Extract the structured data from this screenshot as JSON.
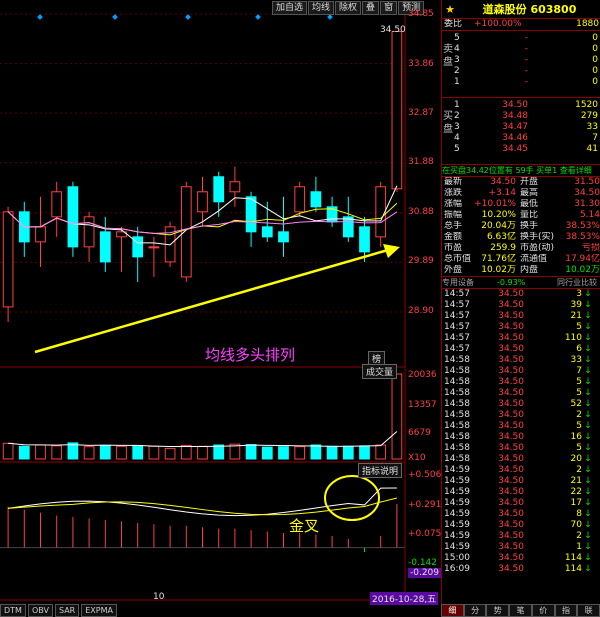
{
  "toolbar": [
    "加自选",
    "均线",
    "除权",
    "叠",
    "窗",
    "预测"
  ],
  "price_axis": [
    "34.85",
    "33.86",
    "32.87",
    "31.88",
    "30.88",
    "29.89",
    "28.90"
  ],
  "max_label": "34.50",
  "vol_axis": [
    "20036",
    "13357",
    "6679",
    "X10"
  ],
  "vol_tag": "成交量",
  "top_tag": "榜",
  "macd_axis": [
    "+0.506",
    "+0.291",
    "+0.075",
    "-0.142",
    "-0.209"
  ],
  "macd_tag": "指标说明",
  "annot_ma": "均线多头排列",
  "annot_cross": "金叉",
  "x_label": "10",
  "date_label": "2016-10-28,五",
  "bottom_tabs": [
    "DTM",
    "OBV",
    "SAR",
    "EXPMA"
  ],
  "colors": {
    "up": "#ff4040",
    "down": "#00ffff",
    "ma5": "#ffffff",
    "ma10": "#ffff00",
    "ma20": "#ff80ff"
  },
  "quote": {
    "name": "道森股份 603800",
    "weibi_label": "委比",
    "weibi_value": "+100.00%",
    "weibi_num": "1880",
    "sell_label": "卖盘",
    "sells": [
      {
        "n": "5",
        "p": "-",
        "v": "0"
      },
      {
        "n": "4",
        "p": "-",
        "v": "0"
      },
      {
        "n": "3",
        "p": "-",
        "v": "0"
      },
      {
        "n": "2",
        "p": "-",
        "v": "0"
      },
      {
        "n": "1",
        "p": "-",
        "v": "0"
      }
    ],
    "buy_label": "买盘",
    "buys": [
      {
        "n": "1",
        "p": "34.50",
        "v": "1520"
      },
      {
        "n": "2",
        "p": "34.48",
        "v": "279"
      },
      {
        "n": "3",
        "p": "34.47",
        "v": "33"
      },
      {
        "n": "4",
        "p": "34.46",
        "v": "7"
      },
      {
        "n": "5",
        "p": "34.45",
        "v": "41"
      }
    ],
    "info_line": "在买盘34.42位置有  59手  买单1 查看详细",
    "stats": [
      [
        "最新",
        "34.50",
        "开盘",
        "31.50"
      ],
      [
        "涨跌",
        "+3.14",
        "最高",
        "34.50"
      ],
      [
        "涨幅",
        "+10.01%",
        "最低",
        "31.30"
      ],
      [
        "振幅",
        "10.20%",
        "量比",
        "5.14"
      ],
      [
        "总手",
        "20.04万",
        "换手",
        "38.53%"
      ],
      [
        "金额",
        "6.63亿",
        "换手(实)",
        "38.53%"
      ],
      [
        "市盈",
        "259.9",
        "市盈(动)",
        "亏损"
      ],
      [
        "总市值",
        "71.76亿",
        "流通值",
        "17.94亿"
      ],
      [
        "外盘",
        "10.02万",
        "内盘",
        "10.02万"
      ]
    ],
    "ticks_header": [
      "专用设备",
      "-0.93%",
      "同行业比较"
    ],
    "ticks": [
      [
        "14:57",
        "34.50",
        "3"
      ],
      [
        "14:57",
        "34.50",
        "39"
      ],
      [
        "14:57",
        "34.50",
        "21"
      ],
      [
        "14:57",
        "34.50",
        "5"
      ],
      [
        "14:57",
        "34.50",
        "110"
      ],
      [
        "14:57",
        "34.50",
        "6"
      ],
      [
        "14:58",
        "34.50",
        "33"
      ],
      [
        "14:58",
        "34.50",
        "7"
      ],
      [
        "14:58",
        "34.50",
        "5"
      ],
      [
        "14:58",
        "34.50",
        "5"
      ],
      [
        "14:58",
        "34.50",
        "52"
      ],
      [
        "14:58",
        "34.50",
        "2"
      ],
      [
        "14:58",
        "34.50",
        "5"
      ],
      [
        "14:58",
        "34.50",
        "16"
      ],
      [
        "14:58",
        "34.50",
        "5"
      ],
      [
        "14:58",
        "34.50",
        "20"
      ],
      [
        "14:59",
        "34.50",
        "2"
      ],
      [
        "14:59",
        "34.50",
        "21"
      ],
      [
        "14:59",
        "34.50",
        "22"
      ],
      [
        "14:59",
        "34.50",
        "17"
      ],
      [
        "14:59",
        "34.50",
        "8"
      ],
      [
        "14:59",
        "34.50",
        "70"
      ],
      [
        "14:59",
        "34.50",
        "2"
      ],
      [
        "14:59",
        "34.50",
        "1"
      ],
      [
        "15:00",
        "34.50",
        "114"
      ],
      [
        "16:09",
        "34.50",
        "114"
      ]
    ],
    "right_tabs": [
      "细",
      "分",
      "势",
      "笔",
      "价",
      "指",
      "联"
    ]
  },
  "chart_data": {
    "type": "candlestick",
    "price_range": [
      28.4,
      34.85
    ],
    "candles": [
      {
        "o": 29.0,
        "c": 30.9,
        "h": 31.0,
        "l": 28.7
      },
      {
        "o": 30.9,
        "c": 30.3,
        "h": 31.1,
        "l": 30.0
      },
      {
        "o": 30.3,
        "c": 30.6,
        "h": 31.2,
        "l": 29.8
      },
      {
        "o": 30.8,
        "c": 31.3,
        "h": 31.5,
        "l": 30.4
      },
      {
        "o": 31.4,
        "c": 30.2,
        "h": 31.5,
        "l": 30.0
      },
      {
        "o": 30.2,
        "c": 30.8,
        "h": 30.9,
        "l": 29.9
      },
      {
        "o": 30.5,
        "c": 29.9,
        "h": 30.8,
        "l": 29.7
      },
      {
        "o": 30.4,
        "c": 30.5,
        "h": 30.6,
        "l": 29.7
      },
      {
        "o": 30.4,
        "c": 30.0,
        "h": 30.6,
        "l": 29.5
      },
      {
        "o": 30.2,
        "c": 30.2,
        "h": 30.4,
        "l": 29.6
      },
      {
        "o": 29.9,
        "c": 30.6,
        "h": 30.7,
        "l": 29.8
      },
      {
        "o": 29.6,
        "c": 31.4,
        "h": 31.5,
        "l": 29.5
      },
      {
        "o": 30.9,
        "c": 31.3,
        "h": 31.6,
        "l": 30.6
      },
      {
        "o": 31.6,
        "c": 31.1,
        "h": 31.7,
        "l": 30.8
      },
      {
        "o": 31.3,
        "c": 31.5,
        "h": 31.8,
        "l": 31.0
      },
      {
        "o": 31.2,
        "c": 30.5,
        "h": 31.3,
        "l": 30.2
      },
      {
        "o": 30.6,
        "c": 30.4,
        "h": 31.1,
        "l": 30.3
      },
      {
        "o": 30.5,
        "c": 30.3,
        "h": 31.2,
        "l": 30.0
      },
      {
        "o": 30.9,
        "c": 31.4,
        "h": 31.5,
        "l": 30.8
      },
      {
        "o": 31.3,
        "c": 31.0,
        "h": 31.6,
        "l": 30.9
      },
      {
        "o": 31.0,
        "c": 30.7,
        "h": 31.2,
        "l": 30.6
      },
      {
        "o": 30.8,
        "c": 30.4,
        "h": 31.2,
        "l": 30.3
      },
      {
        "o": 30.6,
        "c": 30.1,
        "h": 30.8,
        "l": 29.9
      },
      {
        "o": 30.4,
        "c": 31.4,
        "h": 31.5,
        "l": 30.2
      },
      {
        "o": 31.36,
        "c": 34.5,
        "h": 34.5,
        "l": 31.3
      }
    ],
    "volume_max": 20036,
    "volumes": [
      3700,
      3000,
      3300,
      3100,
      3800,
      2900,
      3200,
      3000,
      3100,
      3000,
      2500,
      3200,
      3000,
      3300,
      3500,
      3400,
      2800,
      2900,
      2900,
      3300,
      3000,
      3000,
      3100,
      3300,
      20036
    ],
    "macd_range": [
      -0.209,
      0.506
    ],
    "macd_hist": [
      0.28,
      0.26,
      0.24,
      0.22,
      0.21,
      0.2,
      0.19,
      0.18,
      0.17,
      0.16,
      0.15,
      0.15,
      0.14,
      0.13,
      0.13,
      0.12,
      0.11,
      0.1,
      0.1,
      0.09,
      0.08,
      0.06,
      -0.03,
      0.08,
      0.3
    ]
  }
}
